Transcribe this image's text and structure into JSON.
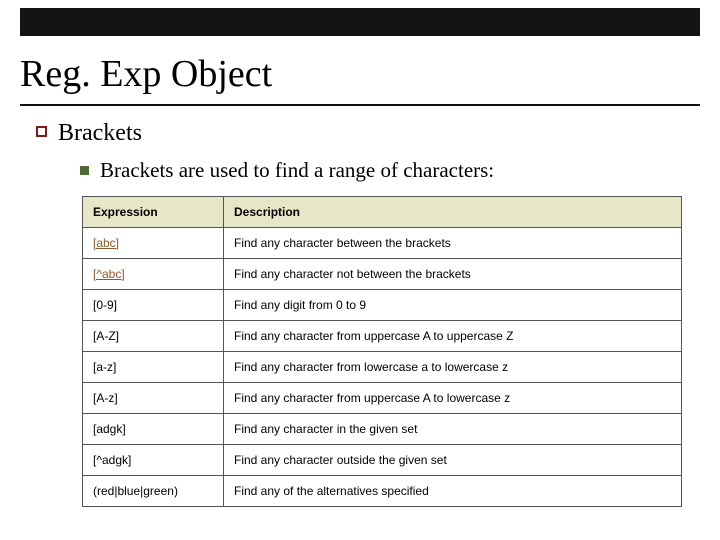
{
  "title": "Reg. Exp Object",
  "bullet1": "Brackets",
  "bullet2": "Brackets are used to find a range of characters:",
  "table": {
    "headers": [
      "Expression",
      "Description"
    ],
    "rows": [
      {
        "expr": "[abc]",
        "link": true,
        "desc": "Find any character between the brackets"
      },
      {
        "expr": "[^abc]",
        "link": true,
        "desc": "Find any character not between the brackets"
      },
      {
        "expr": "[0-9]",
        "link": false,
        "desc": "Find any digit from 0 to 9"
      },
      {
        "expr": "[A-Z]",
        "link": false,
        "desc": "Find any character from uppercase A to uppercase Z"
      },
      {
        "expr": "[a-z]",
        "link": false,
        "desc": "Find any character from lowercase a to lowercase z"
      },
      {
        "expr": "[A-z]",
        "link": false,
        "desc": "Find any character from uppercase A to lowercase z"
      },
      {
        "expr": "[adgk]",
        "link": false,
        "desc": "Find any character in the given set"
      },
      {
        "expr": "[^adgk]",
        "link": false,
        "desc": "Find any character outside the given set"
      },
      {
        "expr": "(red|blue|green)",
        "link": false,
        "desc": "Find any of the alternatives specified"
      }
    ]
  }
}
